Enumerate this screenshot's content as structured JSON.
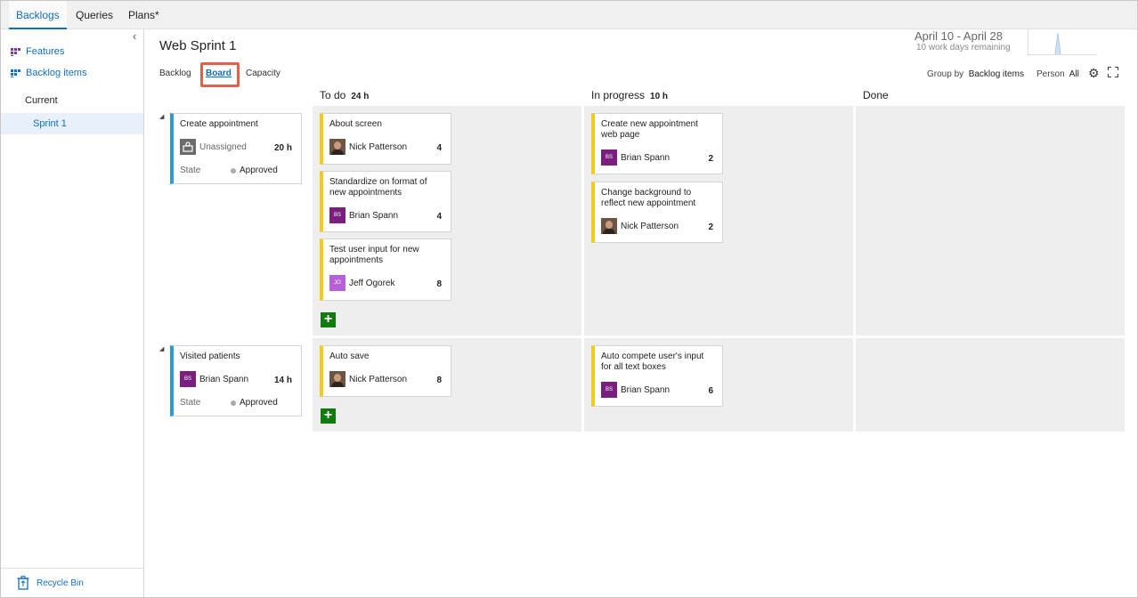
{
  "nav": {
    "tabs": [
      "Backlogs",
      "Queries",
      "Plans*"
    ]
  },
  "sidebar": {
    "collapse": "‹",
    "features": "Features",
    "backlog_items": "Backlog items",
    "current": "Current",
    "sprint": "Sprint 1",
    "recycle": "Recycle Bin"
  },
  "header": {
    "title": "Web Sprint 1",
    "tabs": [
      "Backlog",
      "Board",
      "Capacity"
    ],
    "dates": "April 10 - April 28",
    "days_remaining": "10 work days remaining",
    "group_by_label": "Group by",
    "group_by_value": "Backlog items",
    "person_label": "Person",
    "person_value": "All",
    "gear": "⚙"
  },
  "columns": [
    {
      "name": "To do",
      "hours": "24 h"
    },
    {
      "name": "In progress",
      "hours": "10 h"
    },
    {
      "name": "Done",
      "hours": ""
    }
  ],
  "rows": [
    {
      "parent": {
        "title": "Create appointment",
        "assignee": "Unassigned",
        "hours": "20 h",
        "state_label": "State",
        "state": "Approved"
      },
      "todo": [
        {
          "title": "About screen",
          "assignee": "Nick Patterson",
          "initials": "",
          "remaining": "4"
        },
        {
          "title": "Standardize on format of",
          "title2": "new appointments",
          "assignee": "Brian Spann",
          "initials": "BS",
          "remaining": "4"
        },
        {
          "title": "Test user input for new",
          "title2": "appointments",
          "assignee": "Jeff Ogorek",
          "initials": "JO",
          "remaining": "8"
        }
      ],
      "inprogress": [
        {
          "title": "Create new appointment",
          "title2": "web page",
          "assignee": "Brian Spann",
          "initials": "BS",
          "remaining": "2"
        },
        {
          "title": "Change background to",
          "title2": "reflect new appointment",
          "assignee": "Nick Patterson",
          "initials": "",
          "remaining": "2"
        }
      ]
    },
    {
      "parent": {
        "title": "Visited patients",
        "assignee": "Brian Spann",
        "initials": "BS",
        "hours": "14 h",
        "state_label": "State",
        "state": "Approved"
      },
      "todo": [
        {
          "title": "Auto save",
          "assignee": "Nick Patterson",
          "initials": "",
          "remaining": "8"
        }
      ],
      "inprogress": [
        {
          "title": "Auto compete user's input",
          "title2": "for all text boxes",
          "assignee": "Brian Spann",
          "initials": "BS",
          "remaining": "6"
        }
      ]
    }
  ],
  "add_label": "+",
  "expand_arrow": "◢",
  "colors": {
    "accent": "#106ebe",
    "task": "#f2cb1d",
    "story": "#2b9ad6",
    "highlight": "#e0604b",
    "add": "#107c10"
  }
}
